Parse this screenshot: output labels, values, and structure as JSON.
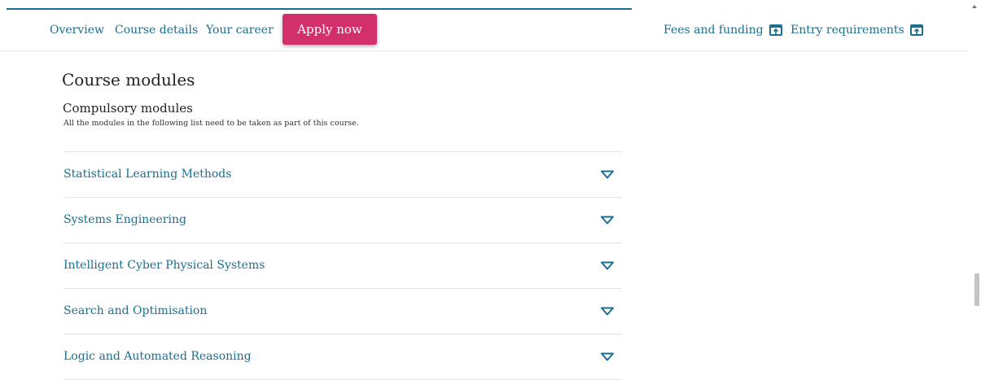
{
  "nav": {
    "overview": "Overview",
    "course_details": "Course details",
    "your_career": "Your career",
    "apply": "Apply now",
    "fees": "Fees and funding",
    "entry": "Entry requirements",
    "fees_icon": "external-tab-icon",
    "entry_icon": "external-tab-icon"
  },
  "section": {
    "title": "Course modules",
    "subtitle": "Compulsory modules",
    "note": "All the modules in the following list need to be taken as part of this course."
  },
  "modules": [
    {
      "name": "Statistical Learning Methods",
      "icon": "chevron-down-icon"
    },
    {
      "name": "Systems Engineering",
      "icon": "chevron-down-icon"
    },
    {
      "name": "Intelligent Cyber Physical Systems",
      "icon": "chevron-down-icon"
    },
    {
      "name": "Search and Optimisation",
      "icon": "chevron-down-icon"
    },
    {
      "name": "Logic and Automated Reasoning",
      "icon": "chevron-down-icon"
    }
  ],
  "colors": {
    "link": "#1a6e8e",
    "apply_button": "#d2306a",
    "divider": "#e3e3e3"
  }
}
